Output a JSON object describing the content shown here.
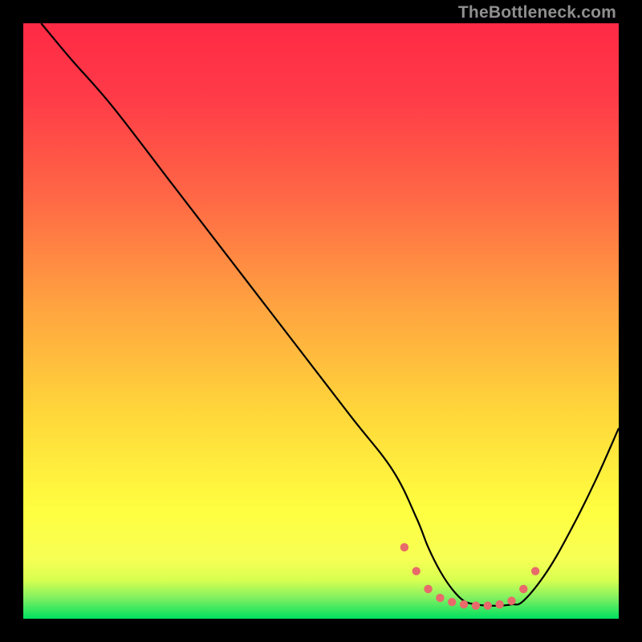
{
  "watermark": "TheBottleneck.com",
  "colors": {
    "bg": "#000000",
    "red": "#ff2a45",
    "orange": "#ffa540",
    "yellow": "#ffff3a",
    "green": "#00e060",
    "line": "#000000",
    "dot": "#e86a6a"
  },
  "chart_data": {
    "type": "line",
    "title": "",
    "xlabel": "",
    "ylabel": "",
    "xlim": [
      0,
      100
    ],
    "ylim": [
      0,
      100
    ],
    "grid": false,
    "legend": false,
    "series": [
      {
        "name": "curve",
        "x": [
          3,
          8,
          15,
          25,
          35,
          45,
          55,
          62,
          66,
          68,
          70,
          72,
          74,
          76,
          78,
          80,
          82,
          84,
          88,
          92,
          96,
          100
        ],
        "y": [
          100,
          94,
          86,
          73,
          60,
          47,
          34,
          25,
          17,
          12,
          8,
          5,
          3,
          2.4,
          2.2,
          2.2,
          2.4,
          3,
          8,
          15,
          23,
          32
        ]
      }
    ],
    "dots": {
      "name": "bottom-cluster",
      "x": [
        64,
        66,
        68,
        70,
        72,
        74,
        76,
        78,
        80,
        82,
        84,
        86
      ],
      "y": [
        12,
        8,
        5,
        3.5,
        2.8,
        2.4,
        2.2,
        2.2,
        2.4,
        3,
        5,
        8
      ]
    },
    "gradient_stops": [
      {
        "pos": 0.0,
        "color": "#ff2a45"
      },
      {
        "pos": 0.12,
        "color": "#ff3a48"
      },
      {
        "pos": 0.3,
        "color": "#ff6a45"
      },
      {
        "pos": 0.48,
        "color": "#ffa540"
      },
      {
        "pos": 0.66,
        "color": "#ffd83a"
      },
      {
        "pos": 0.82,
        "color": "#ffff40"
      },
      {
        "pos": 0.9,
        "color": "#f7ff55"
      },
      {
        "pos": 0.935,
        "color": "#d8ff50"
      },
      {
        "pos": 0.965,
        "color": "#80f060"
      },
      {
        "pos": 1.0,
        "color": "#00e060"
      }
    ]
  }
}
